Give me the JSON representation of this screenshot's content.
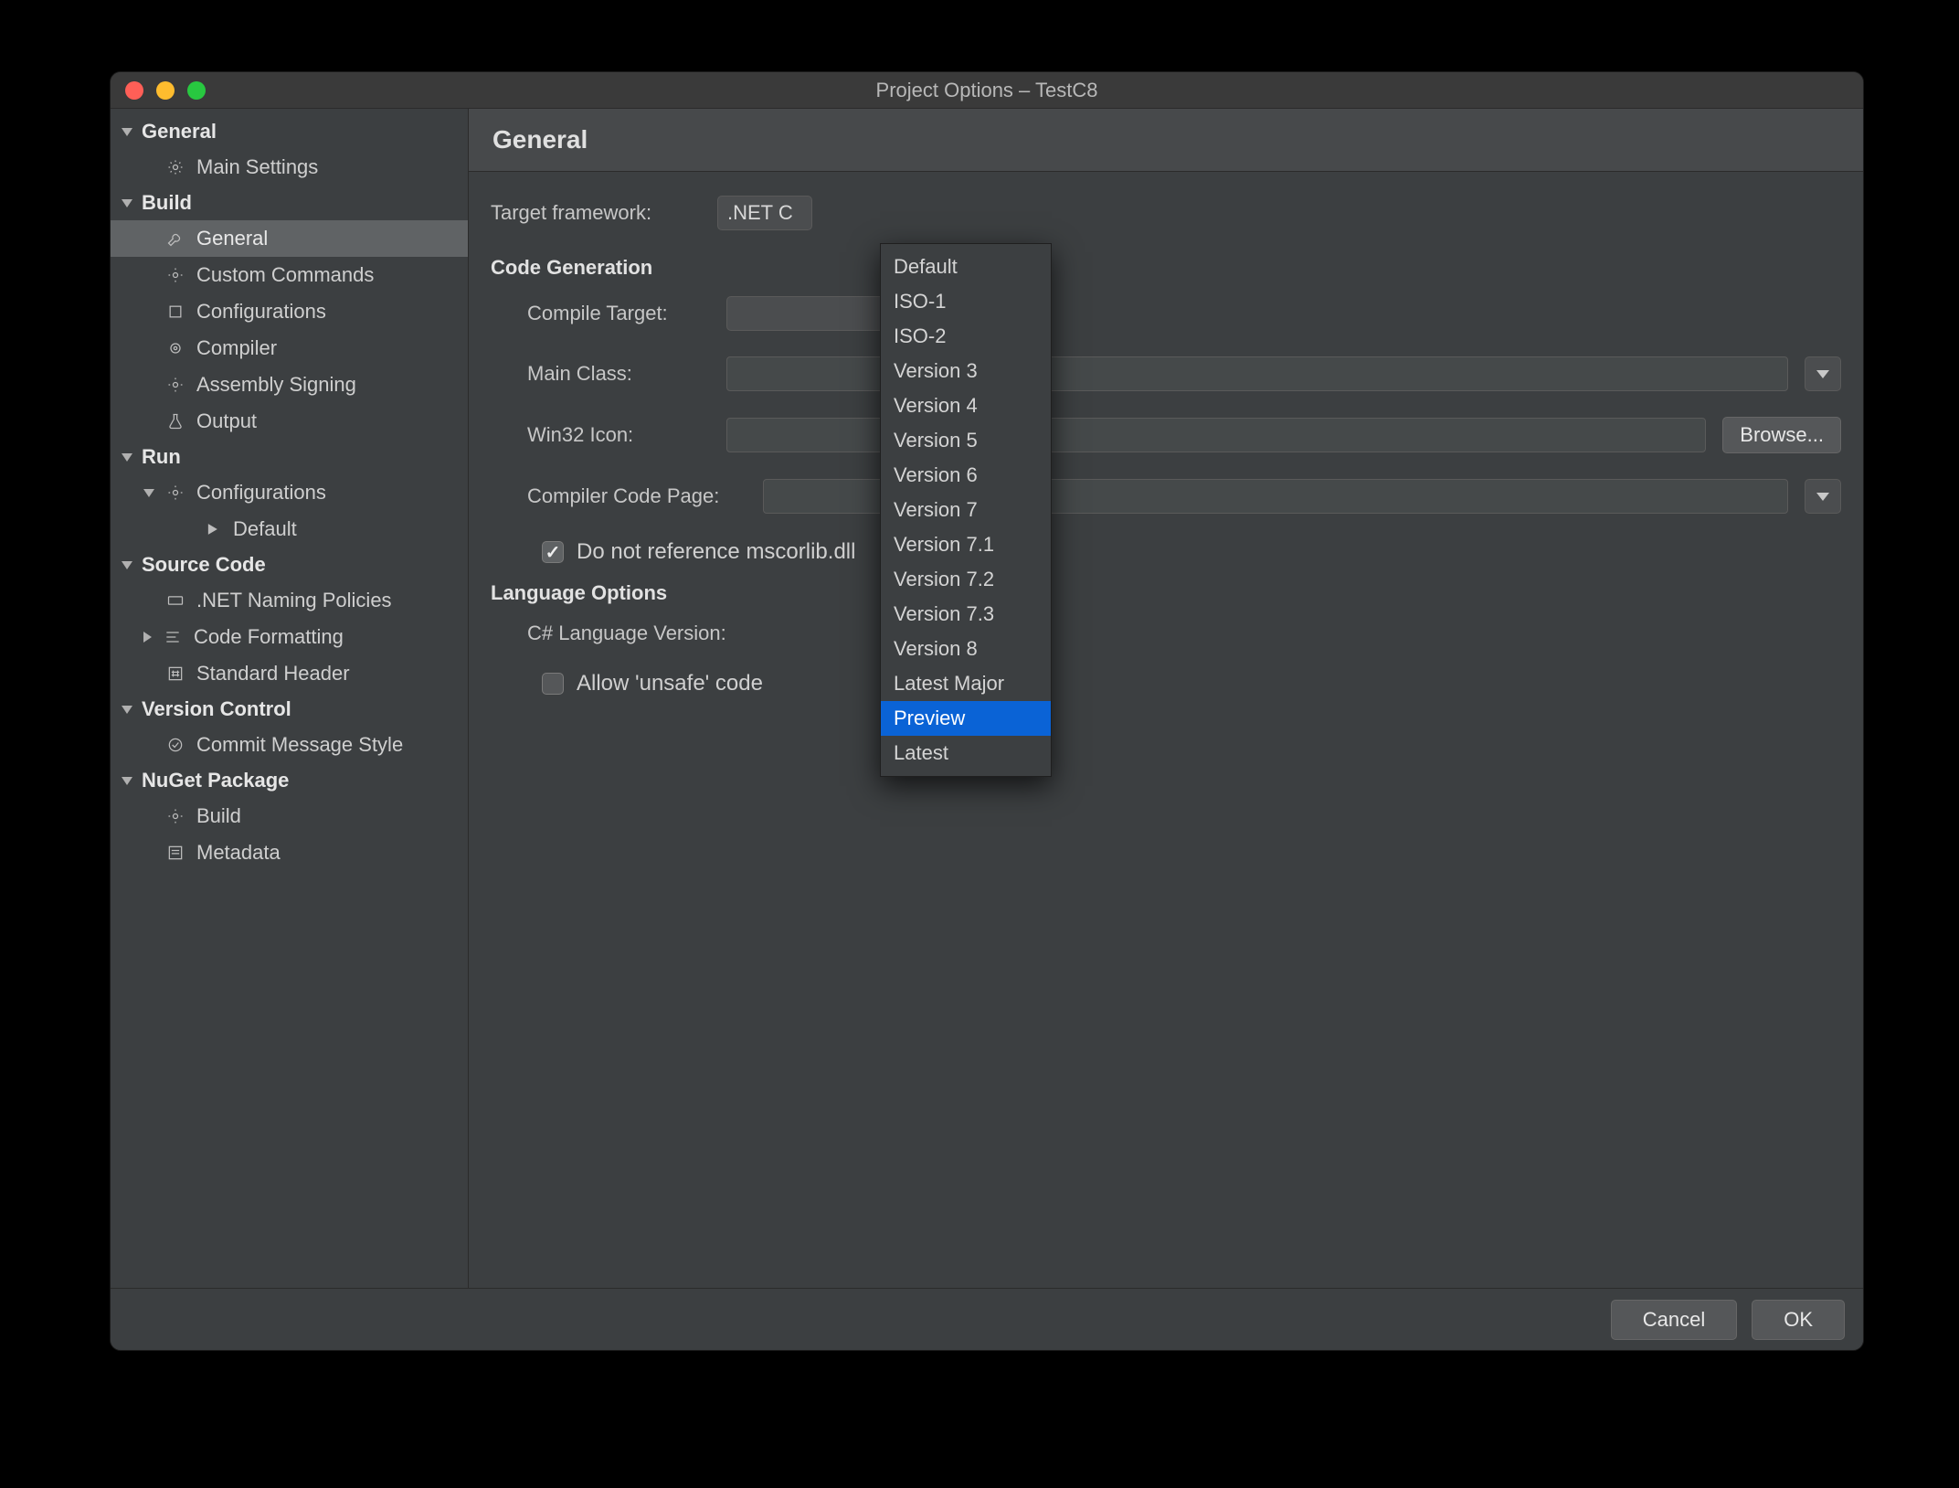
{
  "window": {
    "title": "Project Options – TestC8"
  },
  "sidebar": {
    "general": {
      "label": "General"
    },
    "main_settings": {
      "label": "Main Settings"
    },
    "build": {
      "label": "Build"
    },
    "build_general": {
      "label": "General"
    },
    "custom_commands": {
      "label": "Custom Commands"
    },
    "configurations": {
      "label": "Configurations"
    },
    "compiler": {
      "label": "Compiler"
    },
    "assembly_sign": {
      "label": "Assembly Signing"
    },
    "output": {
      "label": "Output"
    },
    "run": {
      "label": "Run"
    },
    "run_configs": {
      "label": "Configurations"
    },
    "run_default": {
      "label": "Default"
    },
    "source_code": {
      "label": "Source Code"
    },
    "naming": {
      "label": ".NET Naming Policies"
    },
    "code_formatting": {
      "label": "Code Formatting"
    },
    "std_header": {
      "label": "Standard Header"
    },
    "vc": {
      "label": "Version Control"
    },
    "commit_style": {
      "label": "Commit Message Style"
    },
    "nuget": {
      "label": "NuGet Package"
    },
    "nuget_build": {
      "label": "Build"
    },
    "metadata": {
      "label": "Metadata"
    }
  },
  "content": {
    "page_title": "General",
    "target_framework": {
      "label": "Target framework:",
      "value": ".NET C"
    },
    "section_codegen": "Code Generation",
    "compile_target": {
      "label": "Compile Target:"
    },
    "main_class": {
      "label": "Main Class:"
    },
    "win32_icon": {
      "label": "Win32 Icon:",
      "browse": "Browse..."
    },
    "codepage": {
      "label": "Compiler Code Page:"
    },
    "reflib_check": {
      "label": "Do not reference mscorlib.dll",
      "checked": true
    },
    "section_lang": "Language Options",
    "lang_version": {
      "label": "C# Language Version:"
    },
    "unsafe_check": {
      "label": "Allow 'unsafe' code",
      "checked": false
    }
  },
  "menu": {
    "items": [
      "Default",
      "ISO-1",
      "ISO-2",
      "Version 3",
      "Version 4",
      "Version 5",
      "Version 6",
      "Version 7",
      "Version 7.1",
      "Version 7.2",
      "Version 7.3",
      "Version 8",
      "Latest Major",
      "Preview",
      "Latest"
    ],
    "highlighted_index": 13
  },
  "footer": {
    "cancel": "Cancel",
    "ok": "OK"
  }
}
